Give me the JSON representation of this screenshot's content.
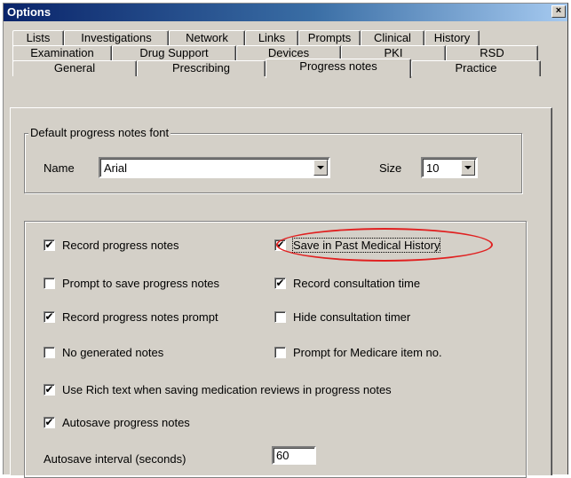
{
  "window": {
    "title": "Options",
    "close_label": "×"
  },
  "tabs": {
    "row1": [
      "Lists",
      "Investigations",
      "Network",
      "Links",
      "Prompts",
      "Clinical",
      "History"
    ],
    "row2": [
      "Examination",
      "Drug Support",
      "Devices",
      "PKI",
      "RSD"
    ],
    "row3": [
      "General",
      "Prescribing",
      "Progress notes",
      "Practice"
    ],
    "active": "Progress notes"
  },
  "font_group": {
    "legend": "Default progress notes font",
    "name_label": "Name",
    "name_value": "Arial",
    "size_label": "Size",
    "size_value": "10"
  },
  "options": {
    "record_progress_notes": {
      "label": "Record progress notes",
      "checked": true
    },
    "save_in_pmh": {
      "label": "Save in Past Medical History",
      "checked": true
    },
    "prompt_to_save": {
      "label": "Prompt to save progress notes",
      "checked": false
    },
    "record_consult_time": {
      "label": "Record consultation time",
      "checked": true
    },
    "record_notes_prompt": {
      "label": "Record progress notes prompt",
      "checked": true
    },
    "hide_consult_timer": {
      "label": "Hide consultation timer",
      "checked": false
    },
    "no_generated_notes": {
      "label": "No generated notes",
      "checked": false
    },
    "prompt_medicare": {
      "label": "Prompt for Medicare item no.",
      "checked": false
    },
    "rich_text": {
      "label": "Use Rich text when saving medication reviews in progress notes",
      "checked": true
    },
    "autosave": {
      "label": "Autosave progress notes",
      "checked": true
    }
  },
  "autosave_interval": {
    "label": "Autosave interval (seconds)",
    "value": "60"
  },
  "check_glyph": "✔",
  "colors": {
    "title_bar": "#0a246a",
    "face": "#d4d0c8",
    "highlight_ring": "#e02020"
  }
}
